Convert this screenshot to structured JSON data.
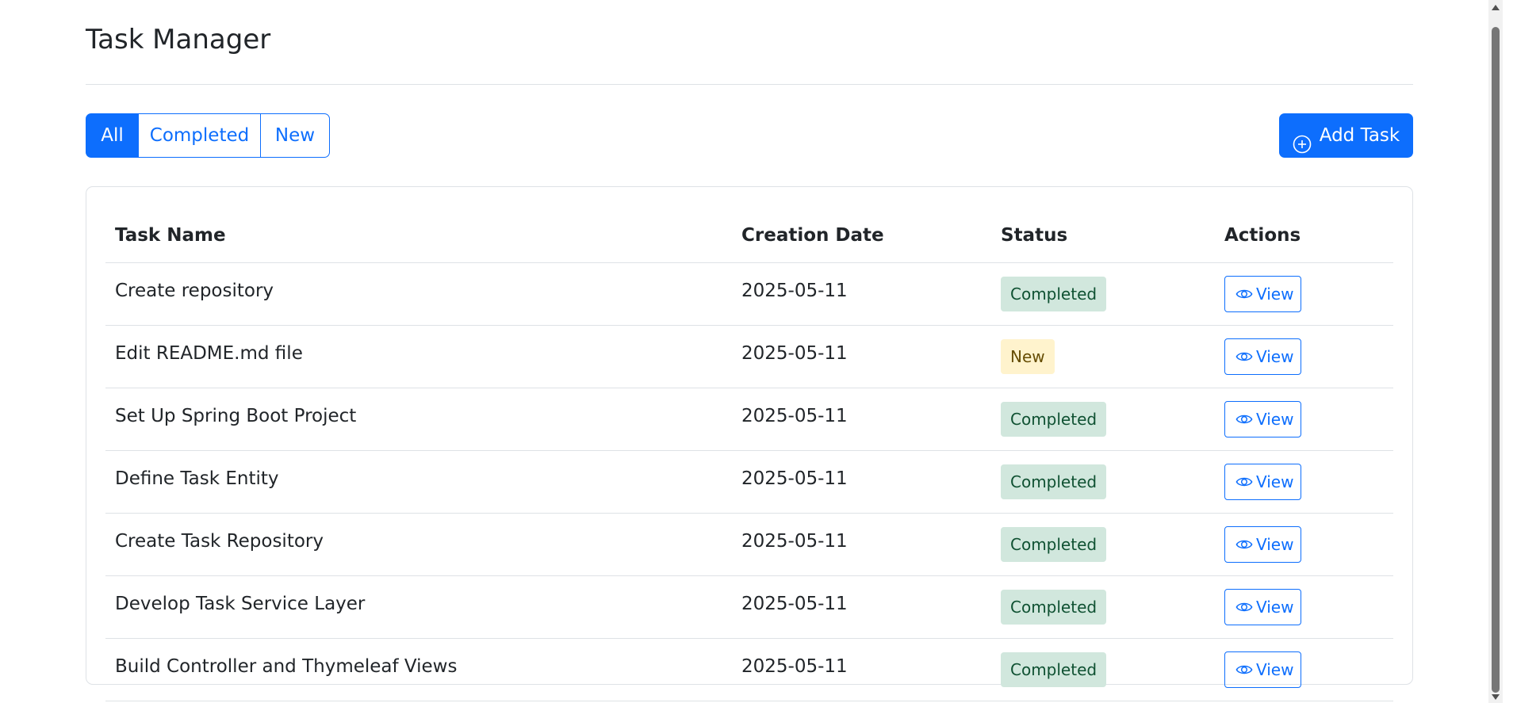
{
  "header": {
    "title": "Task Manager"
  },
  "filters": {
    "all_label": "All",
    "completed_label": "Completed",
    "new_label": "New",
    "active": "All"
  },
  "toolbar": {
    "add_label": "Add Task",
    "add_icon": "plus-circle-icon"
  },
  "table": {
    "headers": {
      "name": "Task Name",
      "date": "Creation Date",
      "status": "Status",
      "actions": "Actions"
    },
    "view_label": "View",
    "view_icon": "eye-icon",
    "rows": [
      {
        "name": "Create repository",
        "date": "2025-05-11",
        "status": "Completed"
      },
      {
        "name": "Edit README.md file",
        "date": "2025-05-11",
        "status": "New"
      },
      {
        "name": "Set Up Spring Boot Project",
        "date": "2025-05-11",
        "status": "Completed"
      },
      {
        "name": "Define Task Entity",
        "date": "2025-05-11",
        "status": "Completed"
      },
      {
        "name": "Create Task Repository",
        "date": "2025-05-11",
        "status": "Completed"
      },
      {
        "name": "Develop Task Service Layer",
        "date": "2025-05-11",
        "status": "Completed"
      },
      {
        "name": "Build Controller and Thymeleaf Views",
        "date": "2025-05-11",
        "status": "Completed"
      }
    ]
  },
  "colors": {
    "primary": "#0d6efd",
    "completed_bg": "#d1e7dd",
    "completed_text": "#0f5132",
    "new_bg": "#fff3cd",
    "new_text": "#664d03"
  }
}
